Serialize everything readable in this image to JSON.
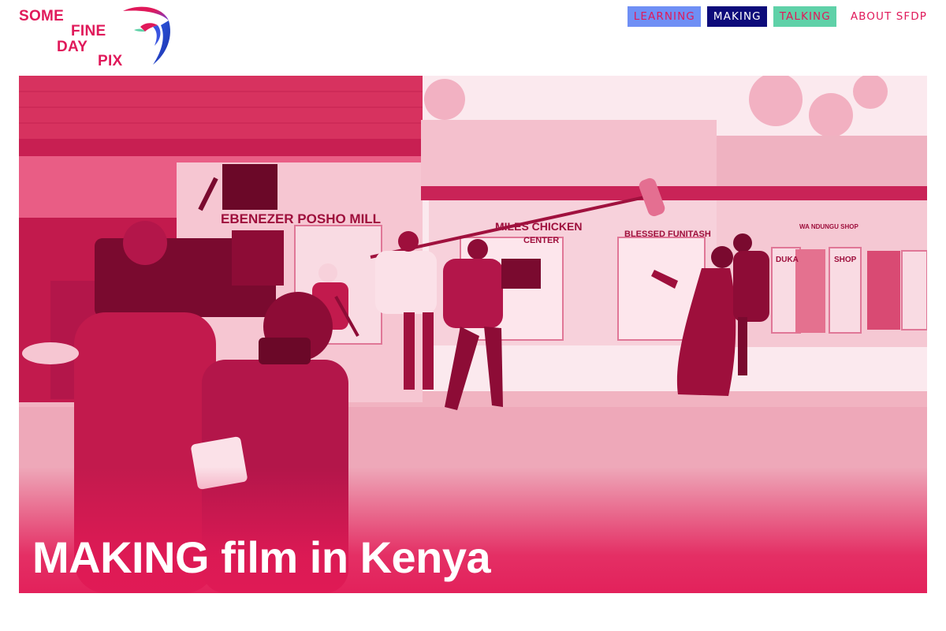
{
  "logo": {
    "words": [
      "SOME",
      "FINE",
      "DAY",
      "PIX"
    ],
    "icon": "swallow-bird-icon"
  },
  "nav": {
    "items": [
      {
        "label": "LEARNING",
        "color": "#6f8ff5"
      },
      {
        "label": "MAKING",
        "color": "#0d0b7a"
      },
      {
        "label": "TALKING",
        "color": "#5fd1a8"
      },
      {
        "label": "ABOUT SFDP"
      }
    ]
  },
  "hero": {
    "title": "MAKING film in Kenya",
    "signs": {
      "mill": "EBENEZER POSHO MILL",
      "chicken_1": "MILES CHICKEN",
      "chicken_2": "CENTER",
      "blessed": "BLESSED FUNITASH",
      "duka": "DUKA",
      "shop": "SHOP",
      "wa_shop": "WA NDUNGU SHOP"
    },
    "tint_color": "#e21a56"
  },
  "colors": {
    "brand": "#e0195a",
    "learning": "#6f8ff5",
    "making": "#0d0b7a",
    "talking": "#5fd1a8"
  }
}
